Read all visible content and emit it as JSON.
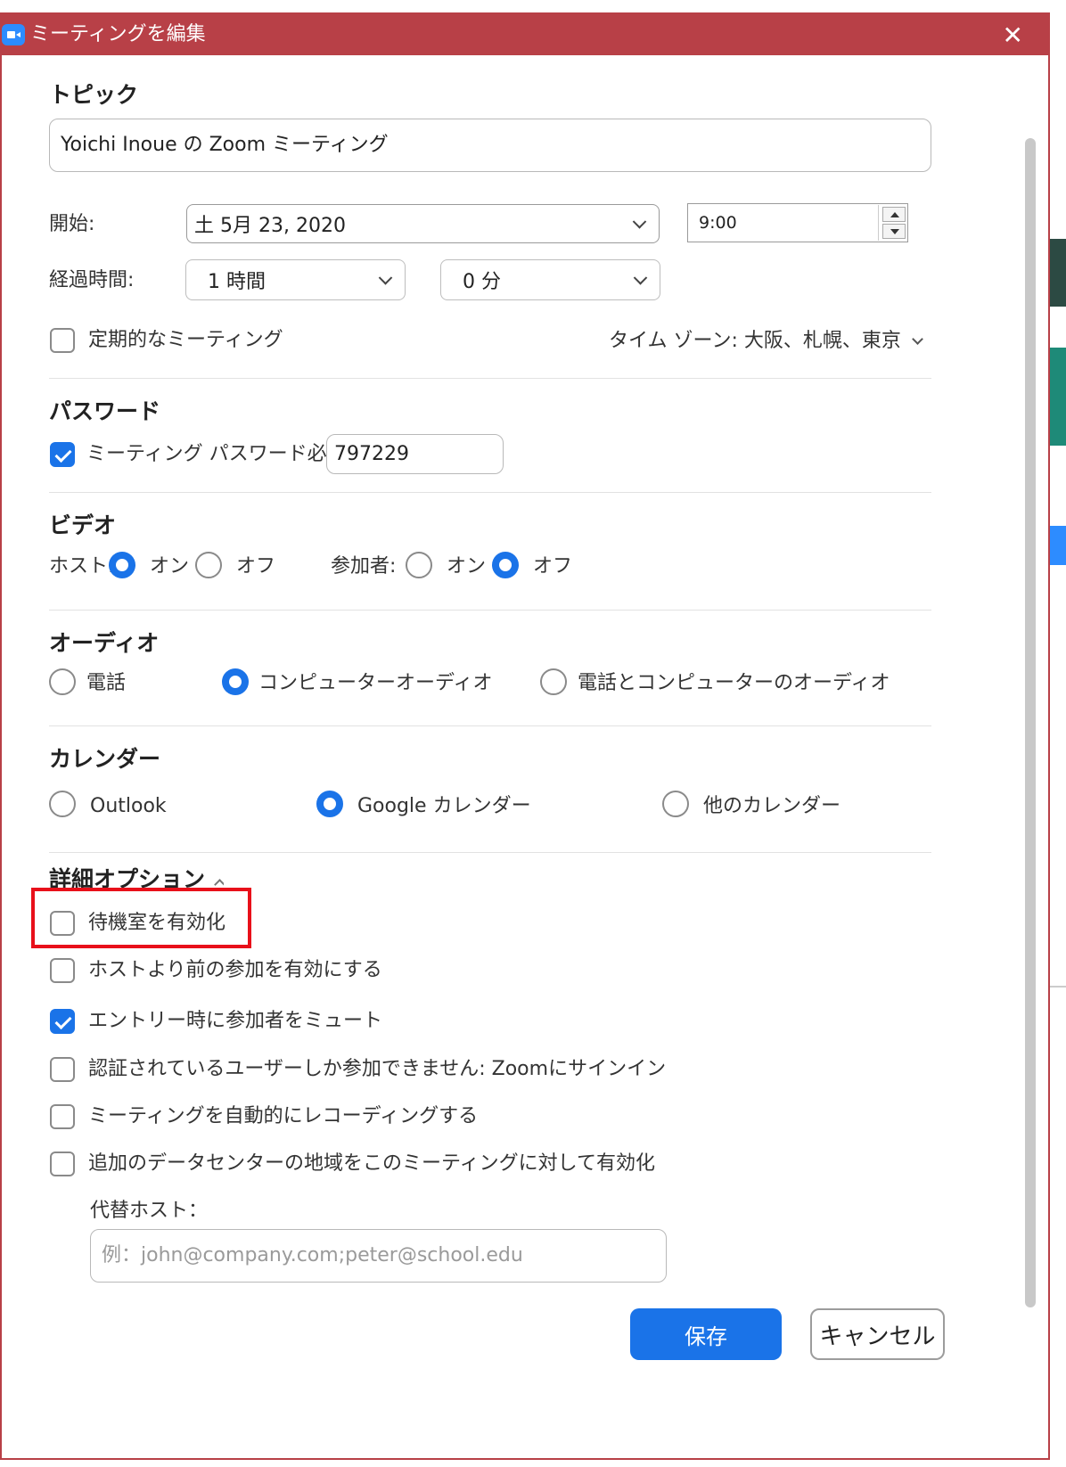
{
  "window": {
    "title": "ミーティングを編集"
  },
  "topic": {
    "label": "トピック",
    "value": "Yoichi Inoue の Zoom ミーティング"
  },
  "schedule": {
    "start_label": "開始:",
    "date_value": "土  5月 23, 2020",
    "time_value": "9:00",
    "duration_label": "経過時間:",
    "hours_value": "1 時間",
    "minutes_value": "0 分",
    "recurring_label": "定期的なミーティング",
    "recurring_checked": false,
    "timezone_label": "タイム ゾーン: 大阪、札幌、東京"
  },
  "password": {
    "title": "パスワード",
    "require_label": "ミーティング パスワード必須",
    "require_checked": true,
    "value": "797229"
  },
  "video": {
    "title": "ビデオ",
    "host_label": "ホスト:",
    "participant_label": "参加者:",
    "on_label": "オン",
    "off_label": "オフ",
    "host_selected": "on",
    "participant_selected": "off"
  },
  "audio": {
    "title": "オーディオ",
    "options": [
      "電話",
      "コンピューターオーディオ",
      "電話とコンピューターのオーディオ"
    ],
    "selected": 1
  },
  "calendar": {
    "title": "カレンダー",
    "options": [
      "Outlook",
      "Google カレンダー",
      "他のカレンダー"
    ],
    "selected": 1
  },
  "advanced": {
    "title": "詳細オプション",
    "options": [
      {
        "label": "待機室を有効化",
        "checked": false
      },
      {
        "label": "ホストより前の参加を有効にする",
        "checked": false
      },
      {
        "label": "エントリー時に参加者をミュート",
        "checked": true
      },
      {
        "label": "認証されているユーザーしか参加できません: Zoomにサインイン",
        "checked": false
      },
      {
        "label": "ミーティングを自動的にレコーディングする",
        "checked": false
      },
      {
        "label": "追加のデータセンターの地域をこのミーティングに対して有効化",
        "checked": false
      }
    ],
    "alt_host_label": "代替ホスト：",
    "alt_host_placeholder": "例：john@company.com;peter@school.edu"
  },
  "buttons": {
    "save": "保存",
    "cancel": "キャンセル"
  },
  "colors": {
    "titlebar": "#b84047",
    "accent": "#1a73e8",
    "highlight": "#e8101a"
  }
}
